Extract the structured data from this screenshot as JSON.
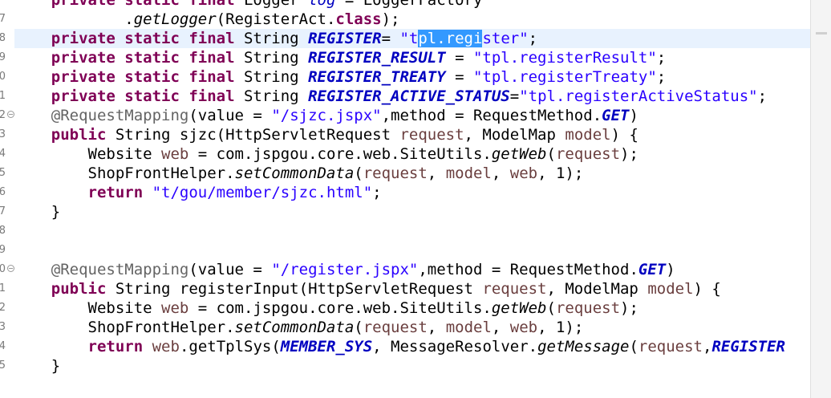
{
  "editor": {
    "gutter": [
      "",
      "7",
      "8",
      "9",
      "0",
      "1",
      "2",
      "3",
      "4",
      "5",
      "6",
      "7",
      "8",
      "9",
      "0",
      "1",
      "2",
      "3",
      "4",
      "5",
      ""
    ],
    "lines": {
      "l0": {
        "a": "    ",
        "b": "private static final",
        "c": " Logger ",
        "d": "log",
        "e": " = LoggerFactory"
      },
      "l1": {
        "a": "            .",
        "b": "getLogger",
        "c": "(RegisterAct.",
        "d": "class",
        "e": ");"
      },
      "l2": {
        "a": "    ",
        "b": "private static final",
        "c": " String ",
        "d": "REGISTER",
        "e": "= ",
        "f": "\"t",
        "g": "pl.regi",
        "h": "ster\"",
        "i": ";"
      },
      "l3": {
        "a": "    ",
        "b": "private static final",
        "c": " String ",
        "d": "REGISTER_RESULT",
        "e": " = ",
        "f": "\"tpl.registerResult\"",
        "g": ";"
      },
      "l4": {
        "a": "    ",
        "b": "private static final",
        "c": " String ",
        "d": "REGISTER_TREATY",
        "e": " = ",
        "f": "\"tpl.registerTreaty\"",
        "g": ";"
      },
      "l5": {
        "a": "    ",
        "b": "private static final",
        "c": " String ",
        "d": "REGISTER_ACTIVE_STATUS",
        "e": "=",
        "f": "\"tpl.registerActiveStatus\"",
        "g": ";"
      },
      "l6": {
        "a": "    ",
        "b": "@RequestMapping",
        "c": "(value = ",
        "d": "\"/sjzc.jspx\"",
        "e": ",method = RequestMethod.",
        "f": "GET",
        "g": ")"
      },
      "l7": {
        "a": "    ",
        "b": "public",
        "c": " String sjzc(HttpServletRequest ",
        "d": "request",
        "e": ", ModelMap ",
        "f": "model",
        "g": ") {"
      },
      "l8": {
        "a": "        Website ",
        "b": "web",
        "c": " = com.jspgou.core.web.SiteUtils.",
        "d": "getWeb",
        "e": "(",
        "f": "request",
        "g": ");"
      },
      "l9": {
        "a": "        ShopFrontHelper.",
        "b": "setCommonData",
        "c": "(",
        "d": "request",
        "e": ", ",
        "f": "model",
        "g": ", ",
        "h": "web",
        "i": ", 1);"
      },
      "l10": {
        "a": "        ",
        "b": "return",
        "c": " ",
        "d": "\"t/gou/member/sjzc.html\"",
        "e": ";"
      },
      "l11": {
        "a": "    }"
      },
      "l14": {
        "a": "    ",
        "b": "@RequestMapping",
        "c": "(value = ",
        "d": "\"/register.jspx\"",
        "e": ",method = RequestMethod.",
        "f": "GET",
        "g": ")"
      },
      "l15": {
        "a": "    ",
        "b": "public",
        "c": " String registerInput(HttpServletRequest ",
        "d": "request",
        "e": ", ModelMap ",
        "f": "model",
        "g": ") {"
      },
      "l16": {
        "a": "        Website ",
        "b": "web",
        "c": " = com.jspgou.core.web.SiteUtils.",
        "d": "getWeb",
        "e": "(",
        "f": "request",
        "g": ");"
      },
      "l17": {
        "a": "        ShopFrontHelper.",
        "b": "setCommonData",
        "c": "(",
        "d": "request",
        "e": ", ",
        "f": "model",
        "g": ", ",
        "h": "web",
        "i": ", 1);"
      },
      "l18": {
        "a": "        ",
        "b": "return",
        "c": " ",
        "d": "web",
        "e": ".getTplSys(",
        "f": "MEMBER_SYS",
        "g": ", MessageResolver.",
        "h": "getMessage",
        "i": "(",
        "j": "request",
        "k": ",",
        "l": "REGISTER"
      },
      "l19": {
        "a": "    }"
      }
    }
  },
  "colors": {
    "keyword": "#7f0055",
    "string": "#2a00ff",
    "constant": "#0000c0",
    "annotation": "#646464",
    "local_variable": "#6a3e3e",
    "current_line": "#e8f2fe",
    "selection": "#3399ff"
  },
  "icons": {
    "fold": "fold-collapse-icon"
  }
}
